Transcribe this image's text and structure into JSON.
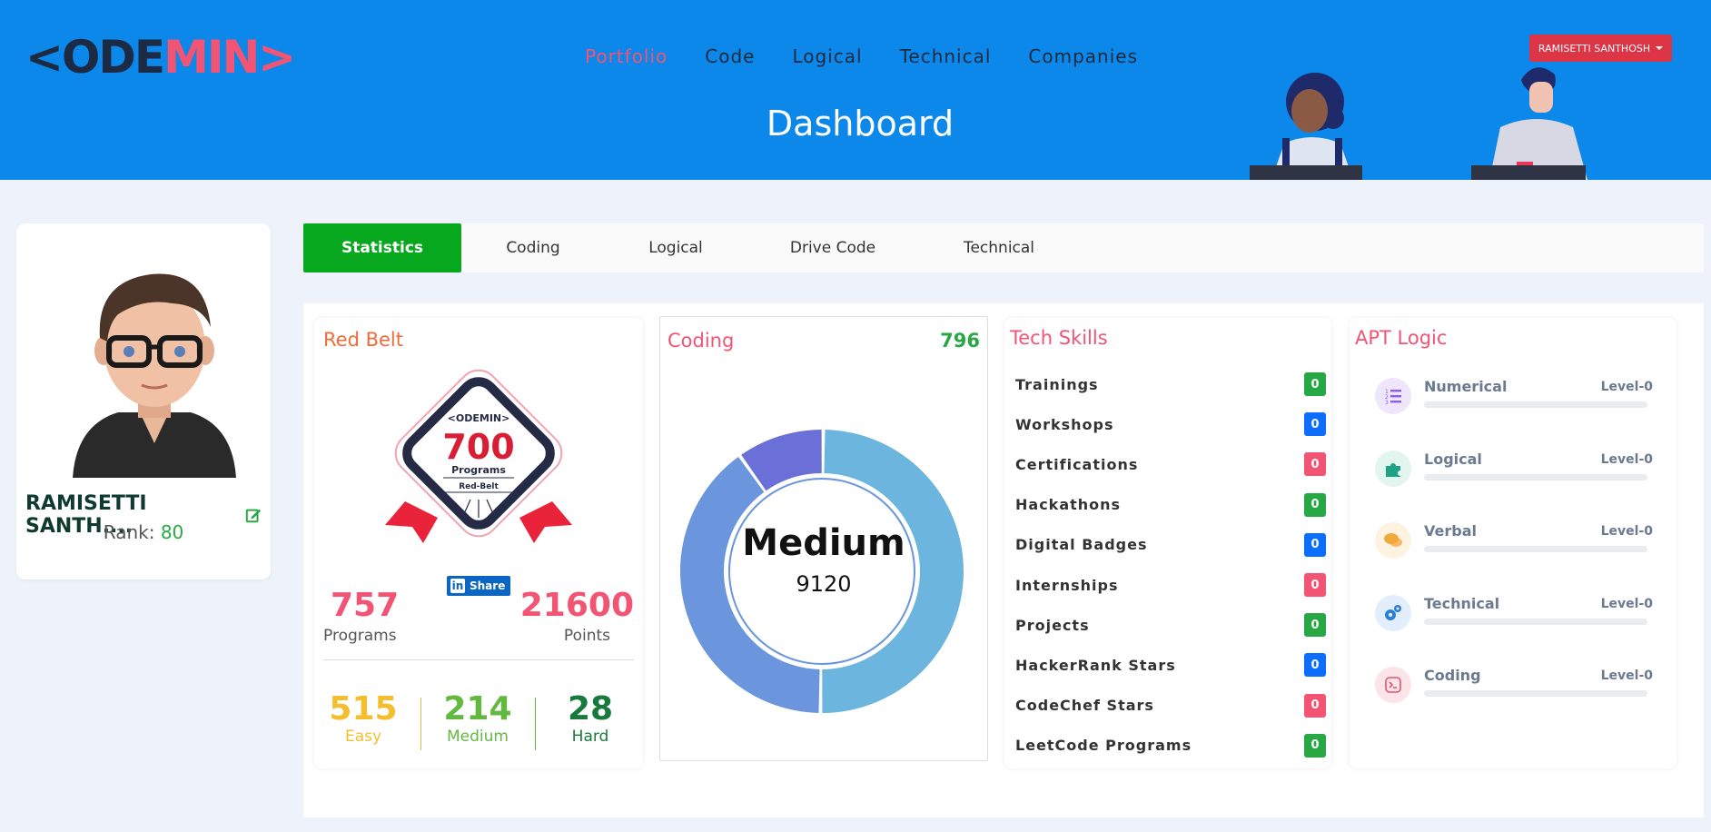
{
  "header": {
    "logo_prefix": "<",
    "logo_dark": "ODE",
    "logo_pink": "MIN",
    "logo_suffix": ">",
    "nav": [
      "Portfolio",
      "Code",
      "Logical",
      "Technical",
      "Companies"
    ],
    "active_nav": "Portfolio",
    "user_button": "RAMISETTI SANTHOSH",
    "page_title": "Dashboard"
  },
  "profile": {
    "name": "RAMISETTI SANTH....",
    "rank_label": "Rank:",
    "rank_value": "80"
  },
  "tabs": [
    "Statistics",
    "Coding",
    "Logical",
    "Drive Code",
    "Technical"
  ],
  "active_tab": "Statistics",
  "red_belt": {
    "title": "Red Belt",
    "badge_logo": "<ODEMIN>",
    "badge_count": "700",
    "badge_unit": "Programs",
    "badge_belt": "Red-Belt",
    "share_label": "Share",
    "share_icon": "in",
    "programs_value": "757",
    "programs_label": "Programs",
    "points_value": "21600",
    "points_label": "Points",
    "easy_value": "515",
    "easy_label": "Easy",
    "medium_value": "214",
    "medium_label": "Medium",
    "hard_value": "28",
    "hard_label": "Hard"
  },
  "coding": {
    "title": "Coding",
    "count": "796",
    "center_label": "Medium",
    "center_value": "9120",
    "segments": [
      {
        "share": 0.5,
        "color": "#6bb5de"
      },
      {
        "share": 0.4,
        "color": "#6b95dc"
      },
      {
        "share": 0.1,
        "color": "#6a70d8"
      }
    ]
  },
  "tech_skills": {
    "title": "Tech Skills",
    "items": [
      {
        "name": "Trainings",
        "value": "0",
        "color": "#28a745"
      },
      {
        "name": "Workshops",
        "value": "0",
        "color": "#0d6efd"
      },
      {
        "name": "Certifications",
        "value": "0",
        "color": "#f25474"
      },
      {
        "name": "Hackathons",
        "value": "0",
        "color": "#28a745"
      },
      {
        "name": "Digital Badges",
        "value": "0",
        "color": "#0d6efd"
      },
      {
        "name": "Internships",
        "value": "0",
        "color": "#f25474"
      },
      {
        "name": "Projects",
        "value": "0",
        "color": "#28a745"
      },
      {
        "name": "HackerRank Stars",
        "value": "0",
        "color": "#0d6efd"
      },
      {
        "name": "CodeChef Stars",
        "value": "0",
        "color": "#f25474"
      },
      {
        "name": "LeetCode Programs",
        "value": "0",
        "color": "#28a745"
      }
    ]
  },
  "apt_logic": {
    "title": "APT Logic",
    "items": [
      {
        "name": "Numerical",
        "level": "Level-0",
        "progress": 0,
        "icon": "list-icon",
        "icon_bg": "#efe6fb",
        "icon_color": "#8b5cf6"
      },
      {
        "name": "Logical",
        "level": "Level-0",
        "progress": 0,
        "icon": "puzzle-icon",
        "icon_bg": "#e3f5ef",
        "icon_color": "#20a384"
      },
      {
        "name": "Verbal",
        "level": "Level-0",
        "progress": 0,
        "icon": "chat-icon",
        "icon_bg": "#fdf3e0",
        "icon_color": "#f0a93b"
      },
      {
        "name": "Technical",
        "level": "Level-0",
        "progress": 0,
        "icon": "gears-icon",
        "icon_bg": "#e2eefb",
        "icon_color": "#2b7fd8"
      },
      {
        "name": "Coding",
        "level": "Level-0",
        "progress": 0,
        "icon": "terminal-icon",
        "icon_bg": "#fce4e8",
        "icon_color": "#e0556c"
      }
    ]
  }
}
